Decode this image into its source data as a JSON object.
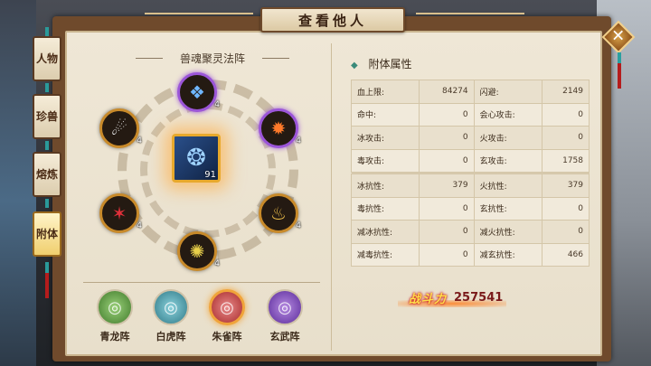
{
  "window": {
    "title": "查看他人",
    "close_icon": "close-icon"
  },
  "side_tabs": [
    {
      "label": "人物",
      "active": false
    },
    {
      "label": "珍兽",
      "active": false
    },
    {
      "label": "熔炼",
      "active": false
    },
    {
      "label": "附体",
      "active": true
    }
  ],
  "formation": {
    "title": "兽魂聚灵法阵",
    "center": {
      "icon": "beast-spirit-icon",
      "level": "91"
    },
    "nodes": [
      {
        "icon": "blue-beast-icon",
        "level": "4"
      },
      {
        "icon": "fire-beast-icon",
        "level": "4"
      },
      {
        "icon": "bell-icon",
        "level": "4"
      },
      {
        "icon": "gold-rune-icon",
        "level": "4"
      },
      {
        "icon": "red-claw-icon",
        "level": "4"
      },
      {
        "icon": "white-tiger-icon",
        "level": "4"
      }
    ],
    "arrays": [
      {
        "label": "青龙阵",
        "color": "#4f9a3a",
        "active": false
      },
      {
        "label": "白虎阵",
        "color": "#3f9aa8",
        "active": false
      },
      {
        "label": "朱雀阵",
        "color": "#c23a3a",
        "active": true
      },
      {
        "label": "玄武阵",
        "color": "#7a3ac0",
        "active": false
      }
    ]
  },
  "attributes": {
    "title": "附体属性",
    "rows": [
      [
        {
          "name": "血上限:",
          "value": "84274"
        },
        {
          "name": "闪避:",
          "value": "2149"
        }
      ],
      [
        {
          "name": "命中:",
          "value": "0"
        },
        {
          "name": "会心攻击:",
          "value": "0"
        }
      ],
      [
        {
          "name": "冰攻击:",
          "value": "0"
        },
        {
          "name": "火攻击:",
          "value": "0"
        }
      ],
      [
        {
          "name": "毒攻击:",
          "value": "0"
        },
        {
          "name": "玄攻击:",
          "value": "1758"
        }
      ],
      [
        {
          "name": "冰抗性:",
          "value": "379"
        },
        {
          "name": "火抗性:",
          "value": "379"
        }
      ],
      [
        {
          "name": "毒抗性:",
          "value": "0"
        },
        {
          "name": "玄抗性:",
          "value": "0"
        }
      ],
      [
        {
          "name": "减冰抗性:",
          "value": "0"
        },
        {
          "name": "减火抗性:",
          "value": "0"
        }
      ],
      [
        {
          "name": "减毒抗性:",
          "value": "0"
        },
        {
          "name": "减玄抗性:",
          "value": "466"
        }
      ]
    ]
  },
  "power": {
    "label": "战斗力",
    "value": "257541"
  }
}
